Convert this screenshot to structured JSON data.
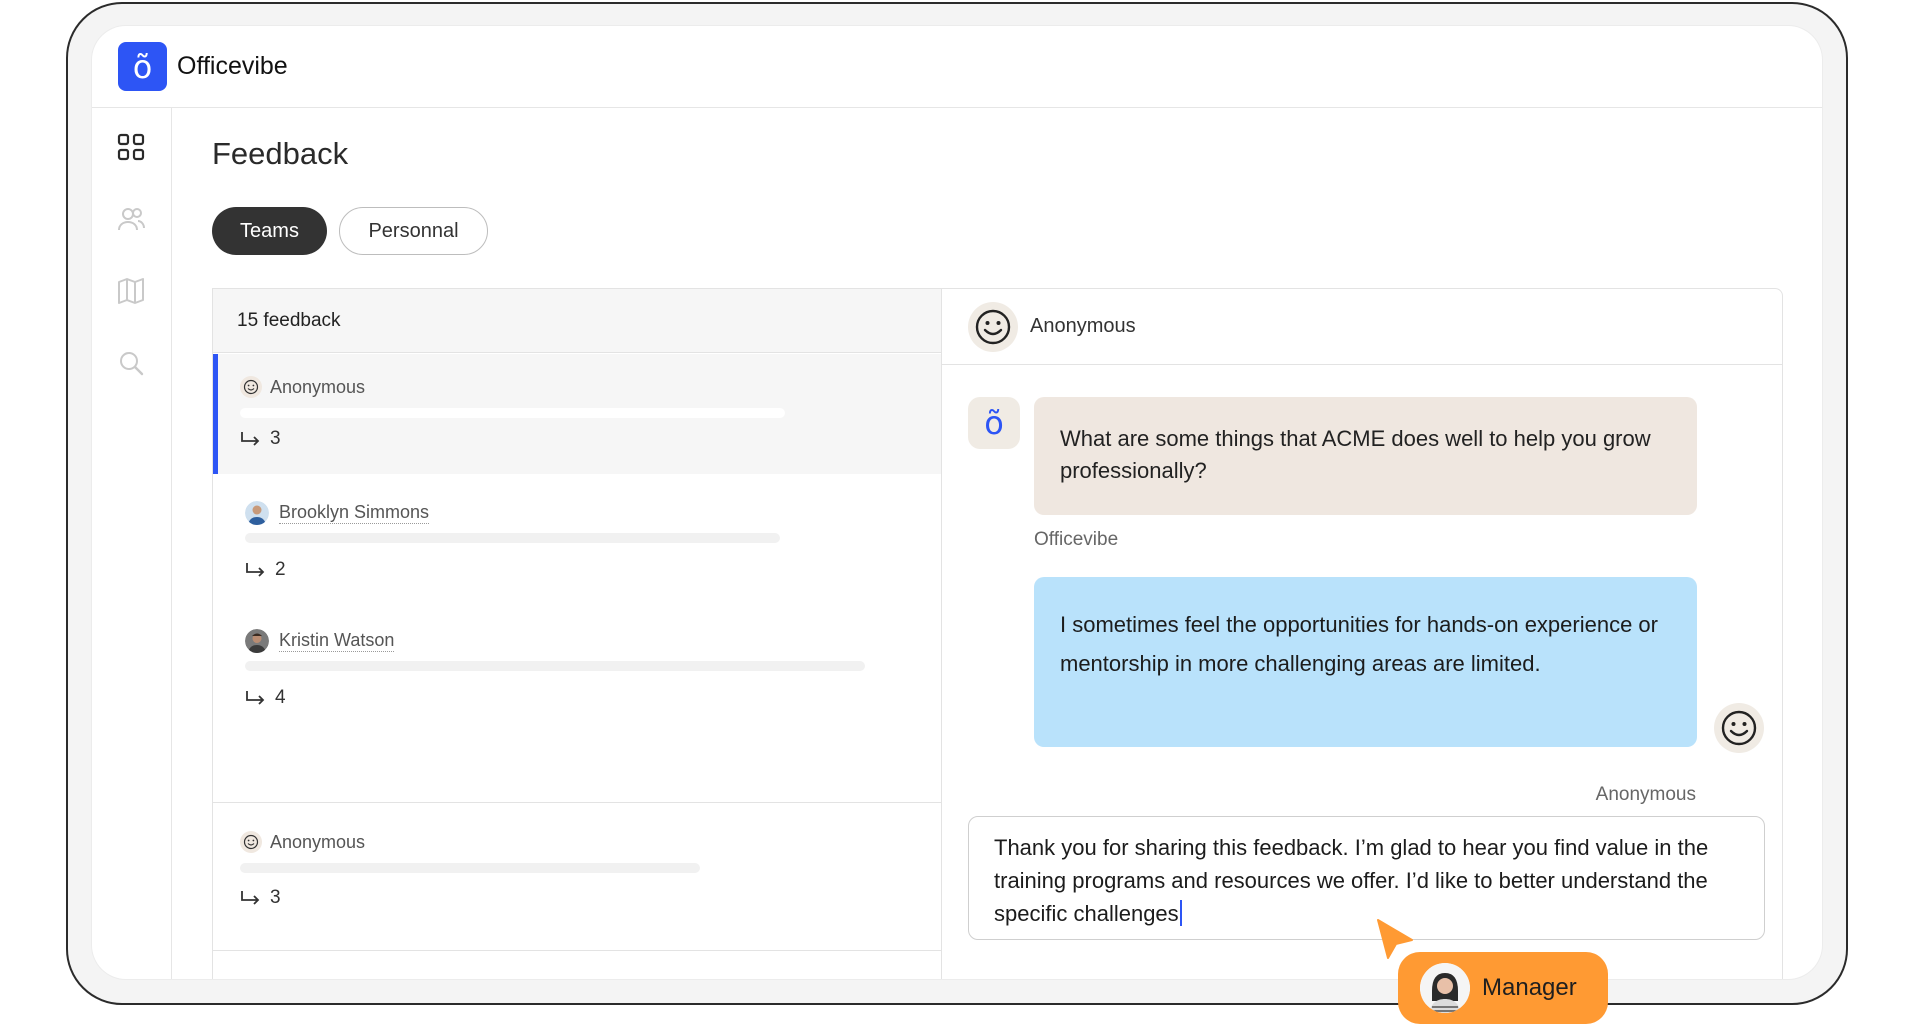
{
  "app": {
    "brand": "Officevibe",
    "logo_glyph": "õ",
    "accent": "#2d55f5"
  },
  "sidebar": {
    "items": [
      {
        "icon": "dashboard-grid-icon",
        "active": true
      },
      {
        "icon": "users-icon",
        "active": false
      },
      {
        "icon": "book-icon",
        "active": false
      },
      {
        "icon": "search-icon",
        "active": false
      }
    ]
  },
  "page": {
    "title": "Feedback"
  },
  "tabs": [
    {
      "label": "Teams",
      "active": true
    },
    {
      "label": "Personnal",
      "active": false
    }
  ],
  "list": {
    "count_label": "15 feedback",
    "items": [
      {
        "author": "Anonymous",
        "avatar": "smiley-icon",
        "replies": "3",
        "selected": true
      },
      {
        "author": "Brooklyn Simmons",
        "avatar": "person-avatar",
        "replies": "2",
        "selected": false
      },
      {
        "author": "Kristin Watson",
        "avatar": "person-avatar",
        "replies": "4",
        "selected": false
      },
      {
        "author": "Anonymous",
        "avatar": "smiley-icon",
        "replies": "3",
        "selected": false
      }
    ]
  },
  "conversation": {
    "header_name": "Anonymous",
    "bot_glyph": "õ",
    "question": {
      "text": "What are some things that ACME does well to help you grow professionally?",
      "sender": "Officevibe",
      "color": "#efe7e0"
    },
    "answer": {
      "text": "I sometimes feel the opportunities for hands-on experience or mentorship in more challenging areas are limited.",
      "sender": "Anonymous",
      "color": "#b9e2fb"
    },
    "reply_draft": "Thank you for sharing this feedback. I’m glad to hear you find value in the training programs and resources we offer. I’d like to better understand the specific challenges"
  },
  "cursor_tag": {
    "label": "Manager",
    "color": "#ff9a33"
  }
}
